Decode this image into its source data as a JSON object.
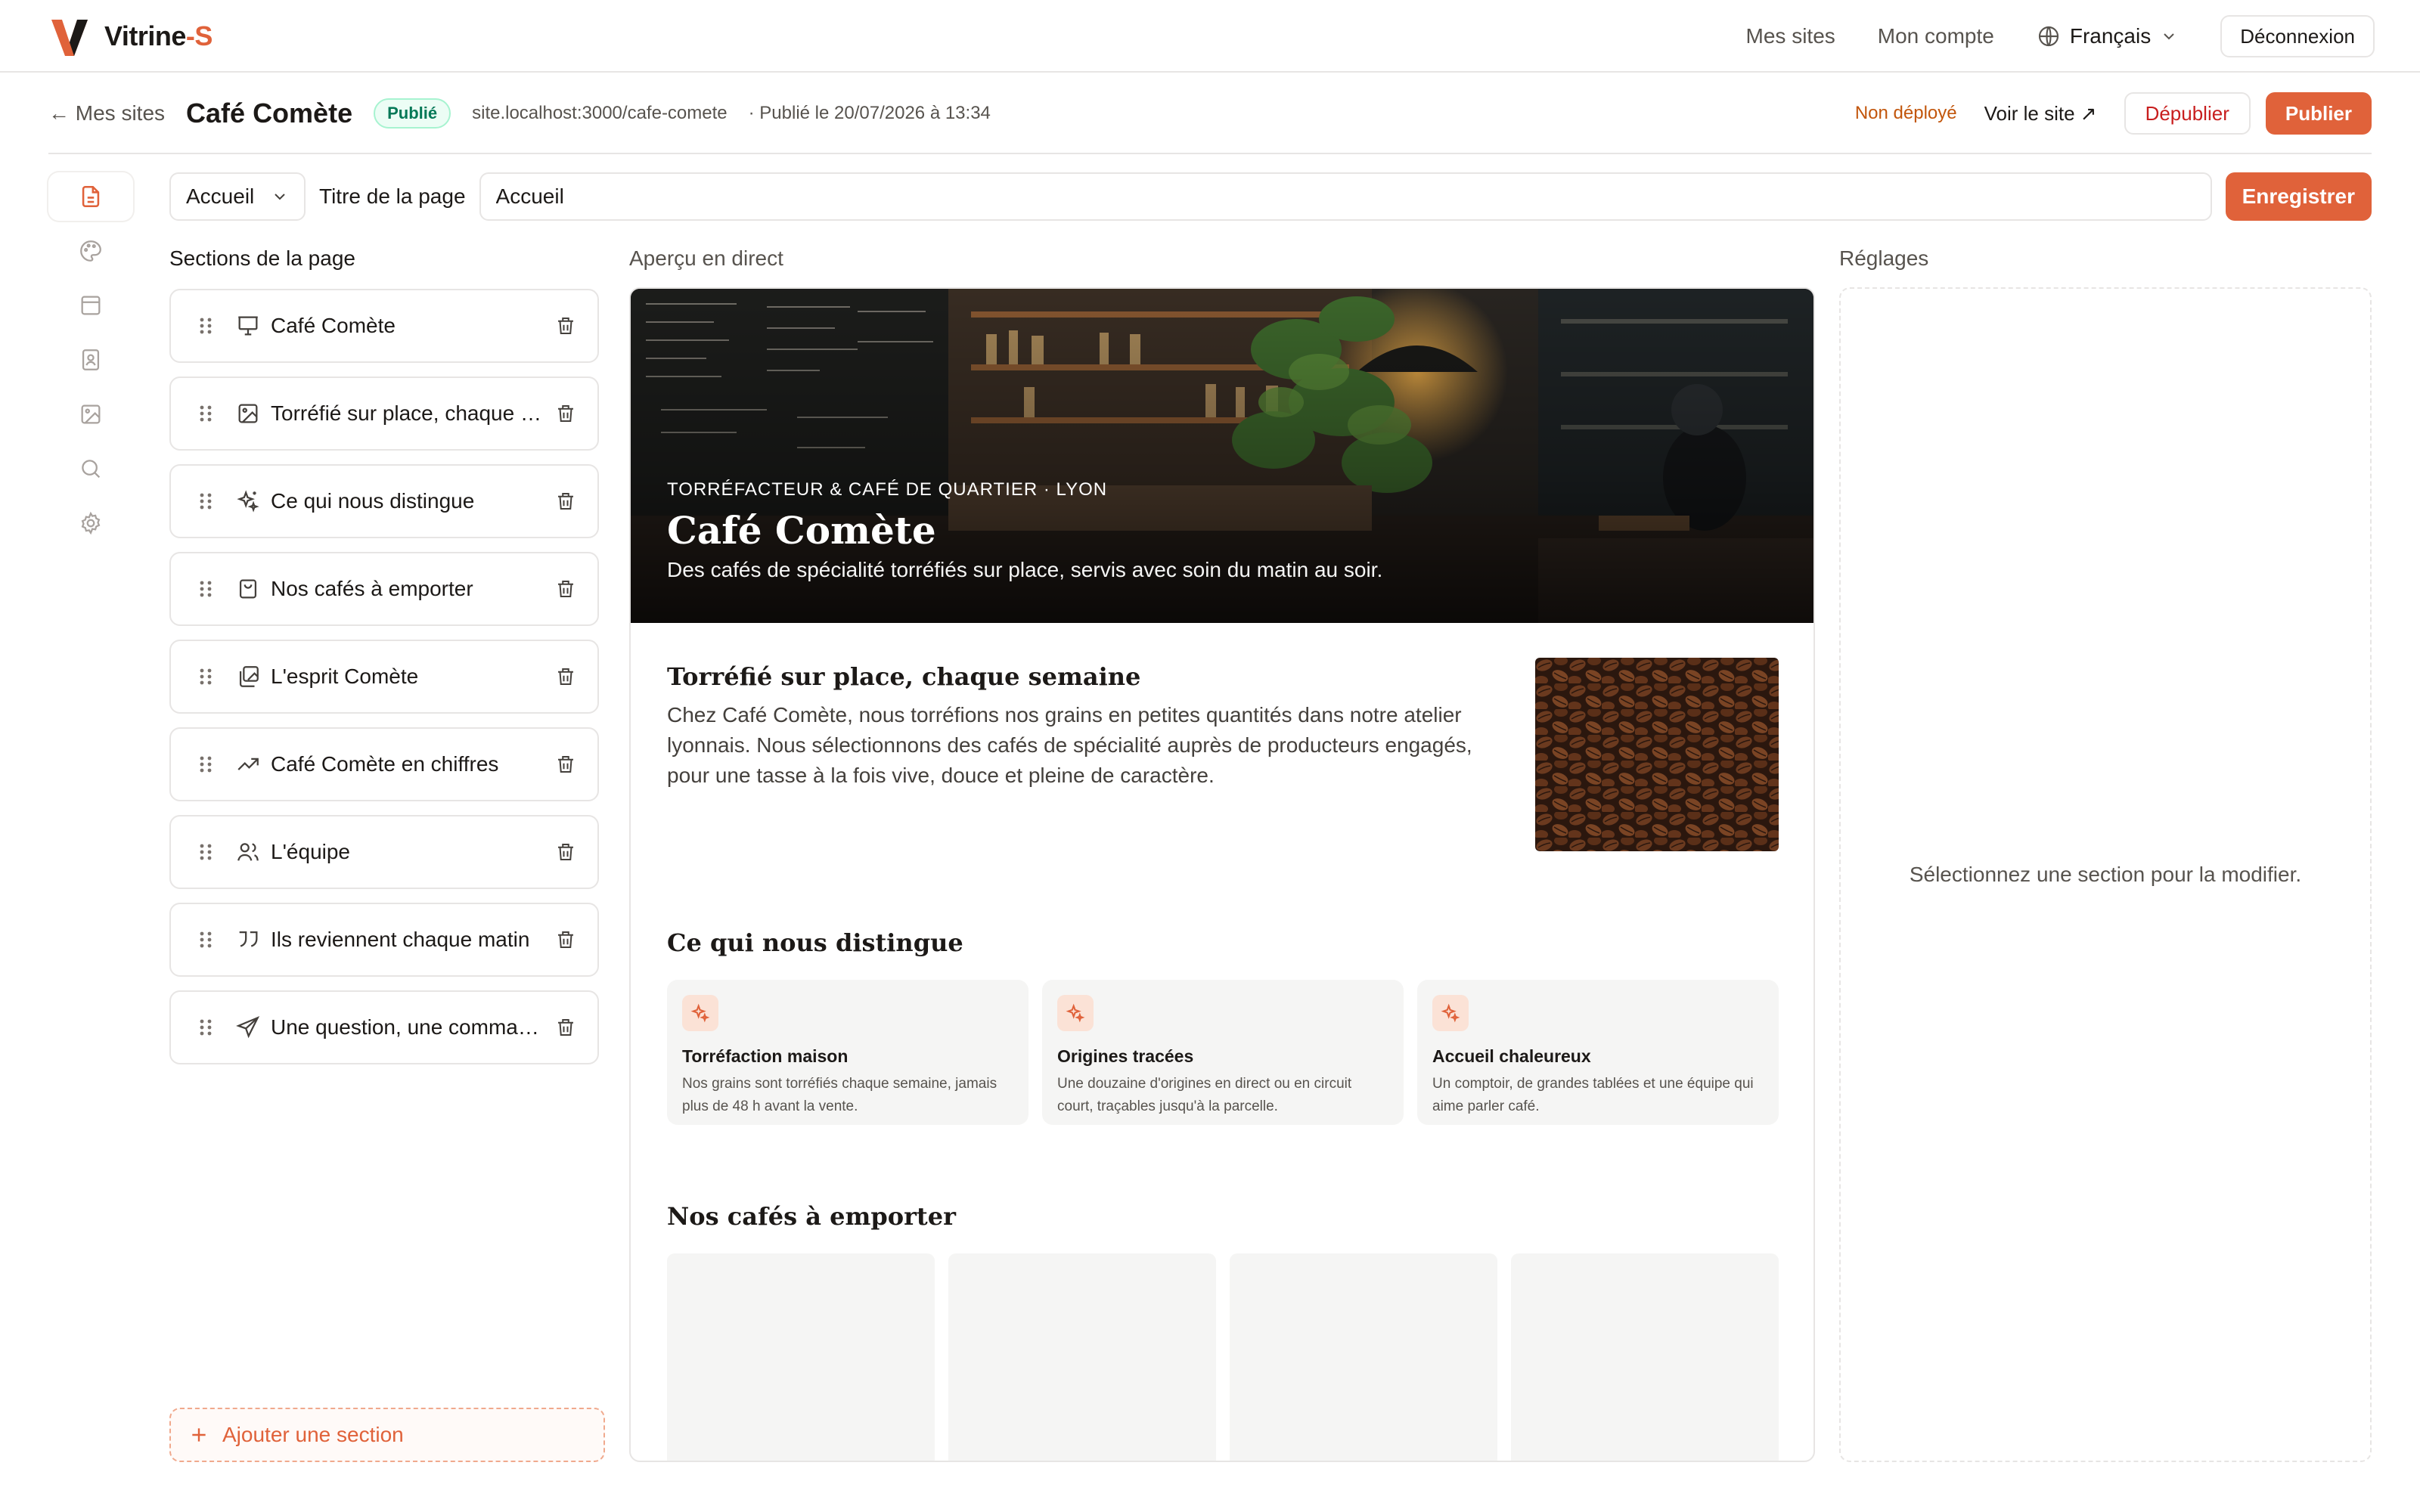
{
  "header": {
    "brand_main": "Vitrine",
    "brand_accent": "-S",
    "nav_my_sites": "Mes sites",
    "nav_my_account": "Mon compte",
    "language": "Français",
    "logout": "Déconnexion"
  },
  "site": {
    "back_label": "← Mes sites",
    "name": "Café Comète",
    "status_badge": "Publié",
    "url": "site.localhost:3000/cafe-comete",
    "published_at": "· Publié le 20/07/2026 à 13:34",
    "deploy_status": "Non déployé",
    "view_site": "Voir le site ↗",
    "unpublish": "Dépublier",
    "publish": "Publier"
  },
  "editor": {
    "page_select": "Accueil",
    "page_title_label": "Titre de la page",
    "page_title_value": "Accueil",
    "save": "Enregistrer"
  },
  "sections": {
    "title": "Sections de la page",
    "add_label": "Ajouter une section",
    "items": [
      {
        "label": "Café Comète",
        "icon": "presentation-icon"
      },
      {
        "label": "Torréfié sur place, chaque semaine",
        "icon": "image-icon"
      },
      {
        "label": "Ce qui nous distingue",
        "icon": "sparkles-icon"
      },
      {
        "label": "Nos cafés à emporter",
        "icon": "shopping-bag-icon"
      },
      {
        "label": "L'esprit Comète",
        "icon": "gallery-icon"
      },
      {
        "label": "Café Comète en chiffres",
        "icon": "trending-up-icon"
      },
      {
        "label": "L'équipe",
        "icon": "users-icon"
      },
      {
        "label": "Ils reviennent chaque matin",
        "icon": "quote-icon"
      },
      {
        "label": "Une question, une commande ?",
        "icon": "send-icon"
      }
    ]
  },
  "preview": {
    "title": "Aperçu en direct",
    "hero": {
      "kicker": "TORRÉFACTEUR & CAFÉ DE QUARTIER · LYON",
      "title": "Café Comète",
      "subtitle": "Des cafés de spécialité torréfiés sur place, servis avec soin du matin au soir."
    },
    "story": {
      "title": "Torréfié sur place, chaque semaine",
      "text": "Chez Café Comète, nous torréfions nos grains en petites quantités dans notre atelier lyonnais. Nous sélectionnons des cafés de spécialité auprès de producteurs engagés, pour une tasse à la fois vive, douce et pleine de caractère."
    },
    "features": {
      "title": "Ce qui nous distingue",
      "items": [
        {
          "title": "Torréfaction maison",
          "text": "Nos grains sont torréfiés chaque semaine, jamais plus de 48 h avant la vente."
        },
        {
          "title": "Origines tracées",
          "text": "Une douzaine d'origines en direct ou en circuit court, traçables jusqu'à la parcelle."
        },
        {
          "title": "Accueil chaleureux",
          "text": "Un comptoir, de grandes tablées et une équipe qui aime parler café."
        }
      ]
    },
    "takeaway": {
      "title": "Nos cafés à emporter"
    }
  },
  "settings": {
    "title": "Réglages",
    "empty": "Sélectionnez une section pour la modifier."
  },
  "colors": {
    "accent": "#e0623a",
    "danger": "#c81e1e",
    "success": "#047857",
    "warning": "#c2560c"
  }
}
